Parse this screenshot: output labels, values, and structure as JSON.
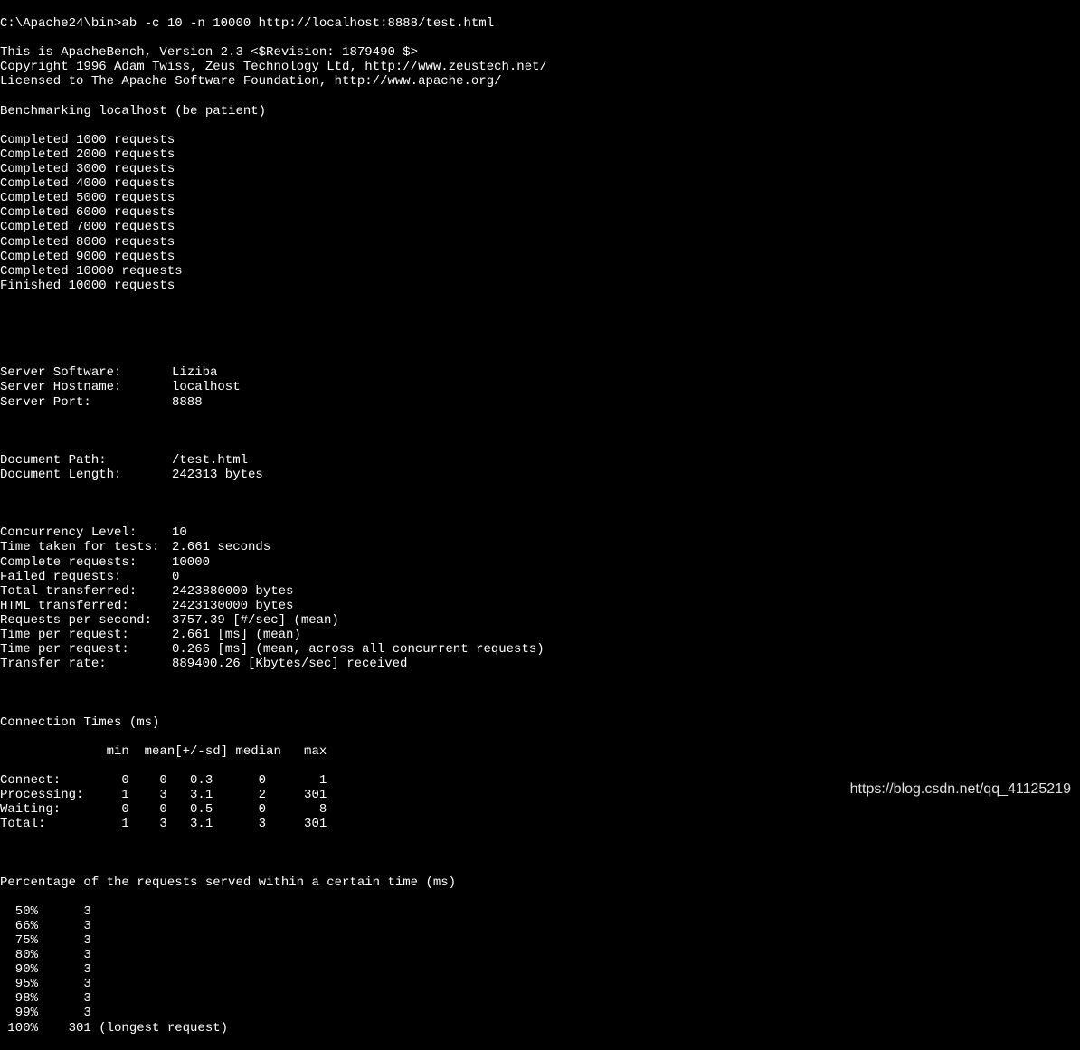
{
  "prompt": "C:\\Apache24\\bin>",
  "command": "ab -c 10 -n 10000 http://localhost:8888/test.html",
  "header_lines": [
    "This is ApacheBench, Version 2.3 <$Revision: 1879490 $>",
    "Copyright 1996 Adam Twiss, Zeus Technology Ltd, http://www.zeustech.net/",
    "Licensed to The Apache Software Foundation, http://www.apache.org/",
    "",
    "Benchmarking localhost (be patient)"
  ],
  "completed_lines": [
    "Completed 1000 requests",
    "Completed 2000 requests",
    "Completed 3000 requests",
    "Completed 4000 requests",
    "Completed 5000 requests",
    "Completed 6000 requests",
    "Completed 7000 requests",
    "Completed 8000 requests",
    "Completed 9000 requests",
    "Completed 10000 requests",
    "Finished 10000 requests"
  ],
  "server_info": [
    {
      "label": "Server Software:",
      "value": "Liziba"
    },
    {
      "label": "Server Hostname:",
      "value": "localhost"
    },
    {
      "label": "Server Port:",
      "value": "8888"
    }
  ],
  "doc_info": [
    {
      "label": "Document Path:",
      "value": "/test.html"
    },
    {
      "label": "Document Length:",
      "value": "242313 bytes"
    }
  ],
  "stats": [
    {
      "label": "Concurrency Level:",
      "value": "10"
    },
    {
      "label": "Time taken for tests:",
      "value": "2.661 seconds"
    },
    {
      "label": "Complete requests:",
      "value": "10000"
    },
    {
      "label": "Failed requests:",
      "value": "0"
    },
    {
      "label": "Total transferred:",
      "value": "2423880000 bytes"
    },
    {
      "label": "HTML transferred:",
      "value": "2423130000 bytes"
    },
    {
      "label": "Requests per second:",
      "value": "3757.39 [#/sec] (mean)"
    },
    {
      "label": "Time per request:",
      "value": "2.661 [ms] (mean)"
    },
    {
      "label": "Time per request:",
      "value": "0.266 [ms] (mean, across all concurrent requests)"
    },
    {
      "label": "Transfer rate:",
      "value": "889400.26 [Kbytes/sec] received"
    }
  ],
  "conn_header": "Connection Times (ms)",
  "conn_cols": "              min  mean[+/-sd] median   max",
  "conn_rows": [
    "Connect:        0    0   0.3      0       1",
    "Processing:     1    3   3.1      2     301",
    "Waiting:        0    0   0.5      0       8",
    "Total:          1    3   3.1      3     301"
  ],
  "perc_header": "Percentage of the requests served within a certain time (ms)",
  "perc_rows": [
    "  50%      3",
    "  66%      3",
    "  75%      3",
    "  80%      3",
    "  90%      3",
    "  95%      3",
    "  98%      3",
    "  99%      3",
    " 100%    301 (longest request)"
  ],
  "watermark": "https://blog.csdn.net/qq_41125219"
}
